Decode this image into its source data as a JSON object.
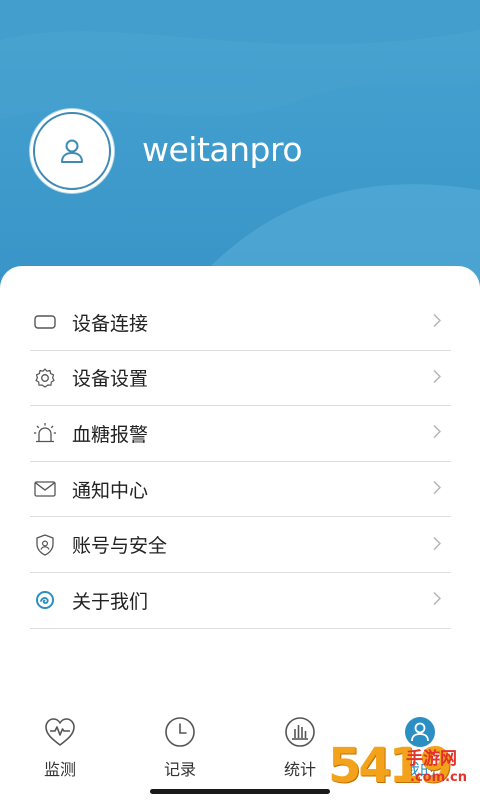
{
  "profile": {
    "username": "weitanpro"
  },
  "menu": {
    "items": [
      {
        "label": "设备连接",
        "icon": "device-connect-icon"
      },
      {
        "label": "设备设置",
        "icon": "gear-icon"
      },
      {
        "label": "血糖报警",
        "icon": "alarm-icon"
      },
      {
        "label": "通知中心",
        "icon": "mail-icon"
      },
      {
        "label": "账号与安全",
        "icon": "shield-icon"
      },
      {
        "label": "关于我们",
        "icon": "app-logo-icon"
      }
    ]
  },
  "tabs": [
    {
      "label": "监测",
      "icon": "heart-monitor-icon",
      "active": false
    },
    {
      "label": "记录",
      "icon": "clock-icon",
      "active": false
    },
    {
      "label": "统计",
      "icon": "bar-chart-icon",
      "active": false
    },
    {
      "label": "我的",
      "icon": "user-icon",
      "active": true
    }
  ],
  "watermark": {
    "number": "5419",
    "brand": "手游网",
    "url": ".com.cn"
  },
  "colors": {
    "header": "#3d9acb",
    "accent": "#2b8fc4",
    "text": "#222222",
    "divider": "#dedede"
  }
}
